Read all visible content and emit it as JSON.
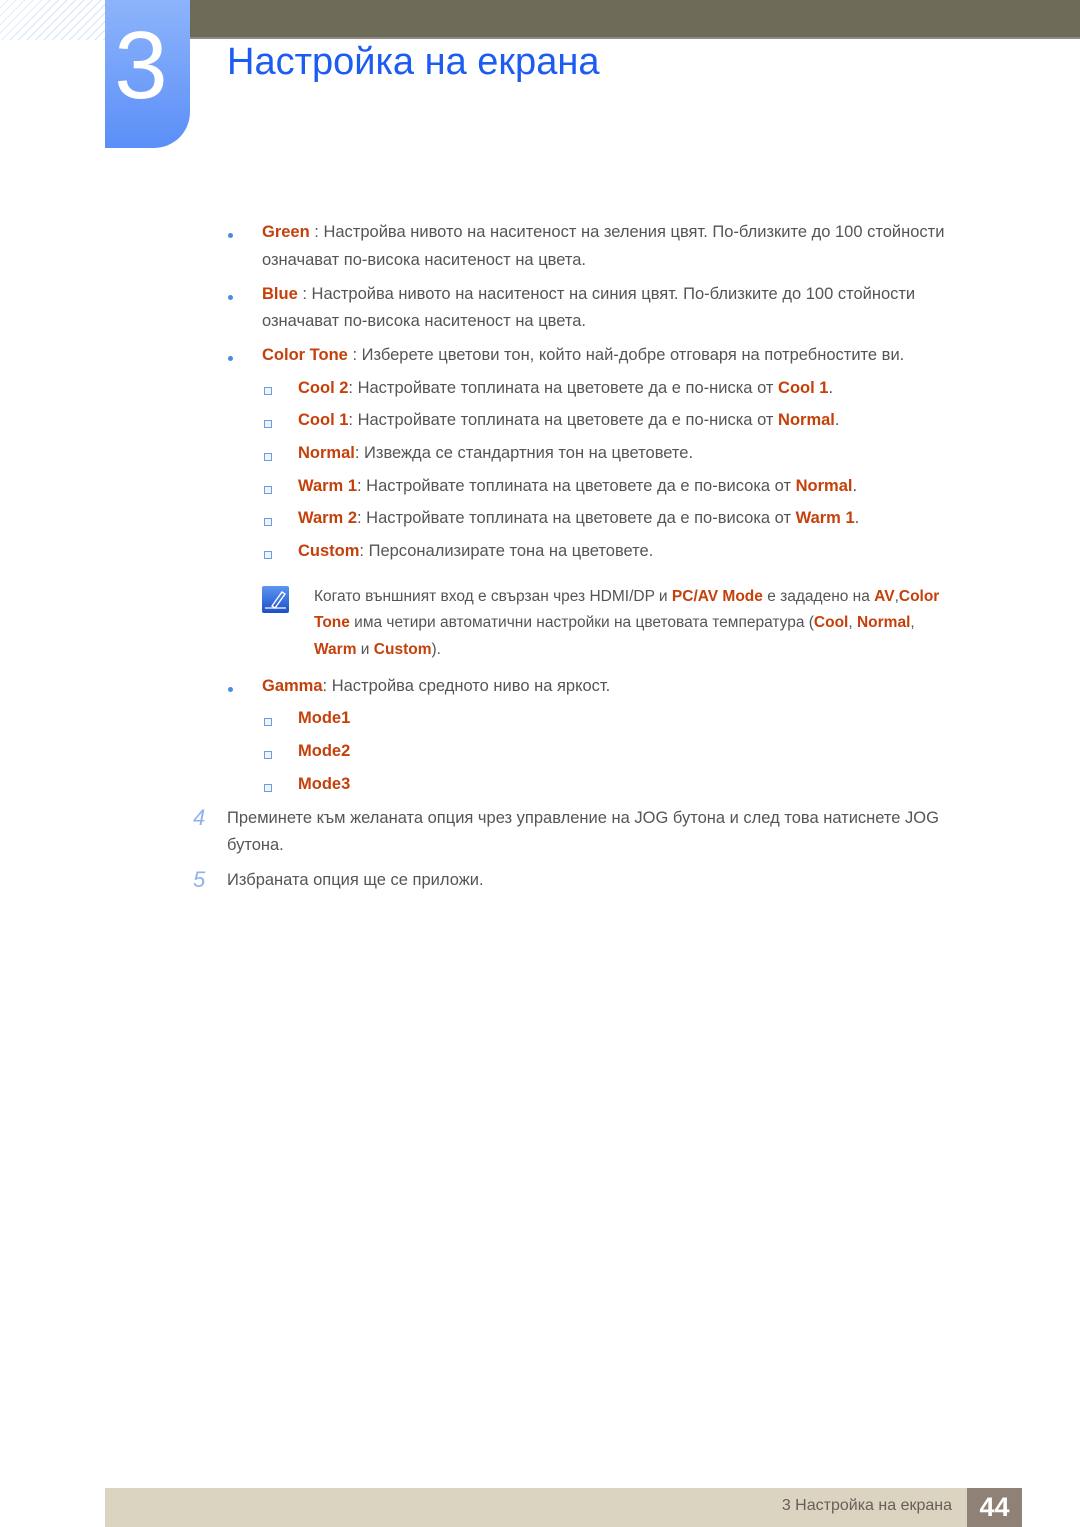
{
  "header": {
    "chapter_number": "3",
    "chapter_title": "Настройка на екрана"
  },
  "items": {
    "green": {
      "term": "Green",
      "sep": " : ",
      "line1": "Настройва нивото на наситеност на зеления цвят. По-близките до 100 стойности",
      "line2": "означават по-висока наситеност на цвета."
    },
    "blue": {
      "term": "Blue",
      "sep": " : ",
      "line1": "Настройва нивото на наситеност на синия цвят. По-близките до 100 стойности",
      "line2": "означават по-висока наситеност на цвета."
    },
    "color_tone": {
      "term": "Color Tone",
      "sep": " : ",
      "text": "Изберете цветови тон, който най-добре отговаря на потребностите ви.",
      "options": [
        {
          "term": "Cool 2",
          "text": ": Настройвате топлината на цветовете да е по-ниска от ",
          "ref": "Cool 1",
          "end": "."
        },
        {
          "term": "Cool 1",
          "text": ": Настройвате топлината на цветовете да е по-ниска от ",
          "ref": "Normal",
          "end": "."
        },
        {
          "term": "Normal",
          "text": ": Извежда се стандартния тон на цветовете.",
          "ref": "",
          "end": ""
        },
        {
          "term": "Warm 1",
          "text": ": Настройвате топлината на цветовете да е по-висока от ",
          "ref": "Normal",
          "end": "."
        },
        {
          "term": "Warm 2",
          "text": ": Настройвате топлината на цветовете да е по-висока от ",
          "ref": "Warm 1",
          "end": "."
        },
        {
          "term": "Custom",
          "text": ": Персонализирате тона на цветовете.",
          "ref": "",
          "end": ""
        }
      ]
    },
    "note": {
      "icon": "note-pencil-icon",
      "p1": "Когато външният вход е свързан чрез HDMI/DP и ",
      "h1": "PC/AV Mode",
      "p2": " е зададено на ",
      "h2": "AV",
      "p3": ",",
      "h3": "Color",
      "h4": "Tone",
      "p4": " има четири автоматични настройки на цветовата температура (",
      "h5": "Cool",
      "p5": ", ",
      "h6": "Normal",
      "p6": ",",
      "h7": "Warm",
      "p7": " и ",
      "h8": "Custom",
      "p8": ")."
    },
    "gamma": {
      "term": "Gamma",
      "text": ": Настройва средното ниво на яркост.",
      "modes": [
        "Mode1",
        "Mode2",
        "Mode3"
      ]
    }
  },
  "steps": [
    {
      "number": "4",
      "line1": "Преминете към желаната опция чрез управление на JOG бутона и след това натиснете JOG",
      "line2": "бутона."
    },
    {
      "number": "5",
      "line1": "Избраната опция ще се приложи.",
      "line2": ""
    }
  ],
  "footer": {
    "label": "3 Настройка на екрана",
    "page": "44"
  }
}
